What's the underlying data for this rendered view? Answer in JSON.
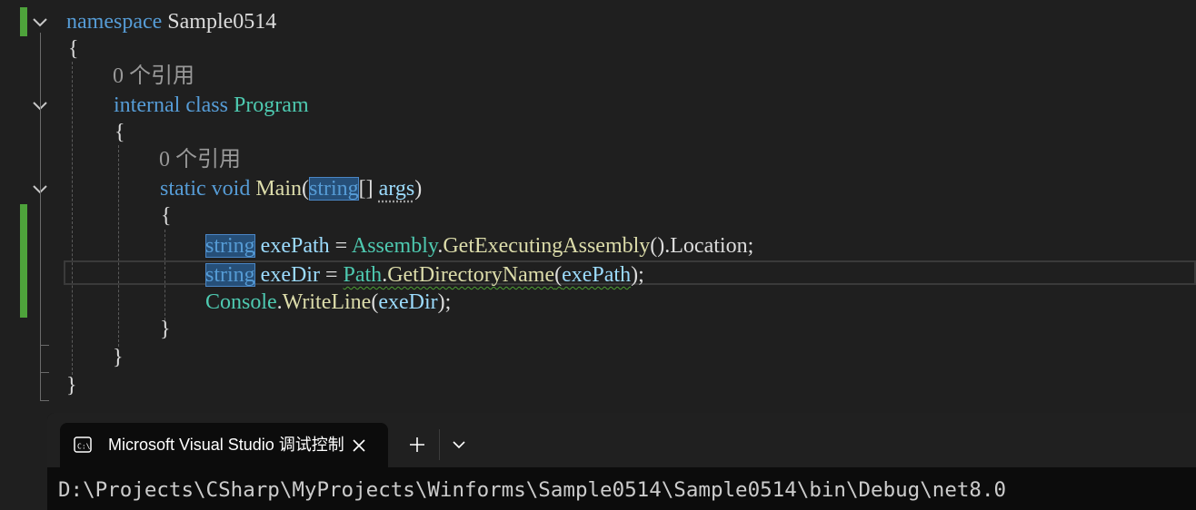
{
  "editor": {
    "references_label": "0 个引用",
    "lines": {
      "namespace_kw": "namespace",
      "namespace_name": "Sample0514",
      "open_brace": "{",
      "close_brace": "}",
      "internal_kw": "internal",
      "class_kw": "class",
      "class_name": "Program",
      "static_kw": "static",
      "void_kw": "void",
      "method_name": "Main",
      "string_kw": "string",
      "args_name": "args",
      "exePath_var": "exePath",
      "exeDir_var": "exeDir",
      "assembly_type": "Assembly",
      "get_executing": "GetExecutingAssembly",
      "location_prop": "Location",
      "path_type": "Path",
      "get_dir_name": "GetDirectoryName",
      "console_type": "Console",
      "writeline": "WriteLine"
    }
  },
  "terminal": {
    "tab_title": "Microsoft Visual Studio 调试控制台",
    "output_line": "D:\\Projects\\CSharp\\MyProjects\\Winforms\\Sample0514\\Sample0514\\bin\\Debug\\net8.0"
  },
  "icons": {
    "fold": "chevron-down-icon",
    "terminal": "console-icon",
    "close": "close-icon",
    "add": "plus-icon",
    "dropdown": "chevron-down-icon"
  },
  "colors": {
    "keyword": "#569cd6",
    "type": "#4ec9b0",
    "method": "#dcdcaa",
    "variable": "#9cdcfe",
    "plain": "#dcdcdc",
    "codelens": "#999999",
    "change_marker": "#4ea33b",
    "editor_bg": "#1f1f1f",
    "terminal_bg": "#0c0c0c"
  }
}
